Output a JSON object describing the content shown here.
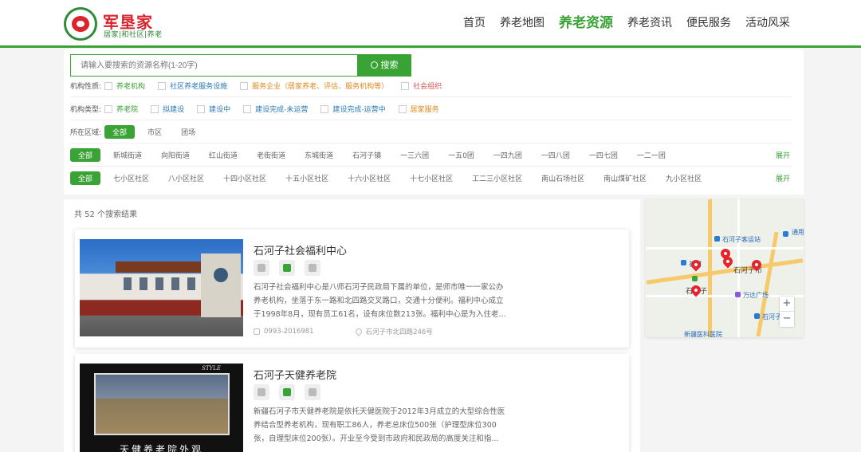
{
  "header": {
    "brand_name": "军垦家",
    "brand_sub": "居家|和社区|养老",
    "nav": [
      {
        "label": "首页"
      },
      {
        "label": "养老地图"
      },
      {
        "label": "养老资源",
        "active": true
      },
      {
        "label": "养老资讯"
      },
      {
        "label": "便民服务"
      },
      {
        "label": "活动风采"
      }
    ]
  },
  "search": {
    "placeholder": "请输入要搜索的资源名称(1-20字)",
    "button_label": "搜索"
  },
  "filters": {
    "nature": {
      "label": "机构性质:",
      "options": [
        "养老机构",
        "社区养老服务设施",
        "服务企业（居家养老、评估、服务机构等）",
        "社会组织"
      ]
    },
    "type": {
      "label": "机构类型:",
      "options": [
        "养老院",
        "拟建设",
        "建设中",
        "建设完成-未运营",
        "建设完成-运营中",
        "居家服务"
      ]
    },
    "region": {
      "label": "所在区域:",
      "all": "全部",
      "options": [
        "市区",
        "团场"
      ]
    },
    "streets": {
      "all": "全部",
      "options": [
        "新城街道",
        "向阳街道",
        "红山街道",
        "老街街道",
        "东城街道",
        "石河子镇",
        "一三六团",
        "一五0团",
        "一四九团",
        "一四八团",
        "一四七团",
        "一二一团"
      ],
      "expand": "展开"
    },
    "communities": {
      "all": "全部",
      "options": [
        "七小区社区",
        "八小区社区",
        "十四小区社区",
        "十五小区社区",
        "十六小区社区",
        "十七小区社区",
        "工二三小区社区",
        "南山石场社区",
        "南山煤矿社区",
        "九小区社区"
      ],
      "expand": "展开"
    }
  },
  "results": {
    "count_text": "共 52 个搜索结果",
    "items": [
      {
        "title": "石河子社会福利中心",
        "desc": "石河子社会福利中心是八师石河子民政局下属的单位，是师市唯一一家公办养老机构，坐落于东一路和北四路交叉路口，交通十分便利。福利中心成立于1998年8月，现有员工61名，设有床位数213张。福利中心是为入住老...",
        "phone": "0993-2016981",
        "address": "石河子市北四路246号",
        "thumb_text": ""
      },
      {
        "title": "石河子天健养老院",
        "desc": "新疆石河子市天健养老院是依托天健医院于2012年3月成立的大型综合性医养结合型养老机构，现有职工86人，养老总床位500张（护理型床位300张，自理型床位200张）。开业至今受到市政府和民政局的高度关注和指...",
        "thumb_caption": "天健养老院外观",
        "thumb_style": "STYLE"
      }
    ]
  },
  "map": {
    "labels": [
      "石河子客运站",
      "石河子市",
      "万达广场",
      "石河子站",
      "石河",
      "通用",
      "石河子",
      "新疆医科医院"
    ],
    "zoom_in": "+",
    "zoom_out": "−"
  },
  "colors": {
    "accent": "#3aa335",
    "brand_red": "#d9232d",
    "marker": "#e5252b"
  }
}
